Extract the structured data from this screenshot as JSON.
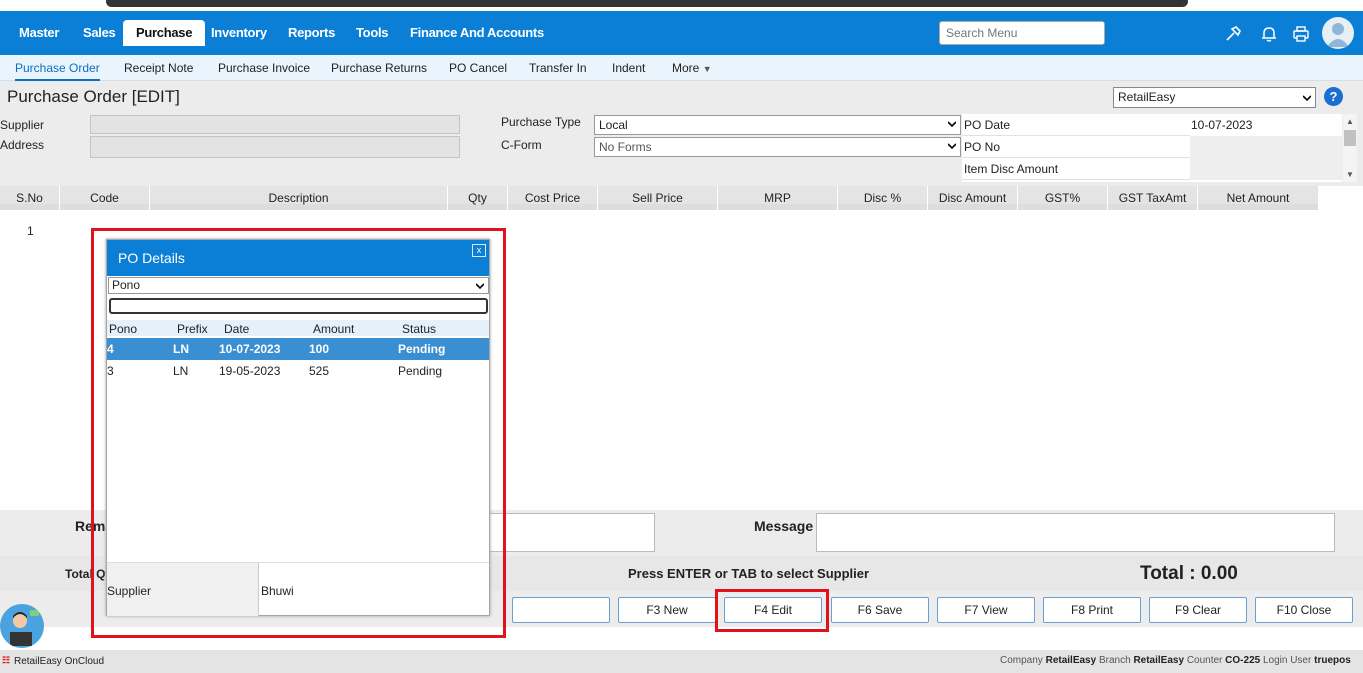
{
  "top_nav": {
    "items": [
      "Master",
      "Sales",
      "Purchase",
      "Inventory",
      "Reports",
      "Tools",
      "Finance And Accounts"
    ],
    "active": "Purchase",
    "search_placeholder": "Search Menu",
    "icons": [
      "hammer-icon",
      "bell-icon",
      "printer-icon",
      "user-avatar"
    ]
  },
  "sub_nav": {
    "items": [
      "Purchase Order",
      "Receipt Note",
      "Purchase Invoice",
      "Purchase Returns",
      "PO Cancel",
      "Transfer In",
      "Indent",
      "More"
    ],
    "active": "Purchase Order"
  },
  "page": {
    "title": "Purchase Order [EDIT]",
    "branch_select": "RetailEasy",
    "help": "?"
  },
  "form": {
    "supplier_label": "Supplier",
    "address_label": "Address",
    "purchase_type_label": "Purchase Type",
    "purchase_type_value": "Local",
    "cform_label": "C-Form",
    "cform_value": "No Forms",
    "po_date_label": "PO Date",
    "po_date_value": "10-07-2023",
    "po_no_label": "PO No",
    "item_disc_label": "Item Disc Amount"
  },
  "table": {
    "columns": [
      "S.No",
      "Code",
      "Description",
      "Qty",
      "Cost Price",
      "Sell Price",
      "MRP",
      "Disc %",
      "Disc Amount",
      "GST%",
      "GST TaxAmt",
      "Net Amount"
    ],
    "rows": [
      [
        "1"
      ]
    ]
  },
  "bottom": {
    "remarks_label": "Rema",
    "message_label": "Message",
    "total_qty_label": "Total Qt",
    "hint": "Press ENTER or TAB to select Supplier",
    "total": "Total : 0.00",
    "buttons": [
      "F3 New",
      "F4 Edit",
      "F6 Save",
      "F7 View",
      "F8 Print",
      "F9 Clear",
      "F10 Close"
    ]
  },
  "status_bar": {
    "app": "RetailEasy OnCloud",
    "company_label": "Company",
    "company": "RetailEasy",
    "branch_label": "Branch",
    "branch": "RetailEasy",
    "counter_label": "Counter",
    "counter": "CO-225",
    "login_label": "Login User",
    "login": "truepos"
  },
  "modal": {
    "title": "PO Details",
    "close": "x",
    "search_by": "Pono",
    "columns": [
      "Pono",
      "Prefix",
      "Date",
      "Amount",
      "Status"
    ],
    "rows": [
      [
        "4",
        "LN",
        "10-07-2023",
        "100",
        "Pending"
      ],
      [
        "3",
        "LN",
        "19-05-2023",
        "525",
        "Pending"
      ]
    ],
    "selected_row": 0,
    "supplier_label": "Supplier",
    "supplier_value": "Bhuwi"
  },
  "colors": {
    "nav_blue": "#0b7fd6",
    "highlight_red": "#e0121c",
    "selected_row": "#3a8fd3"
  }
}
